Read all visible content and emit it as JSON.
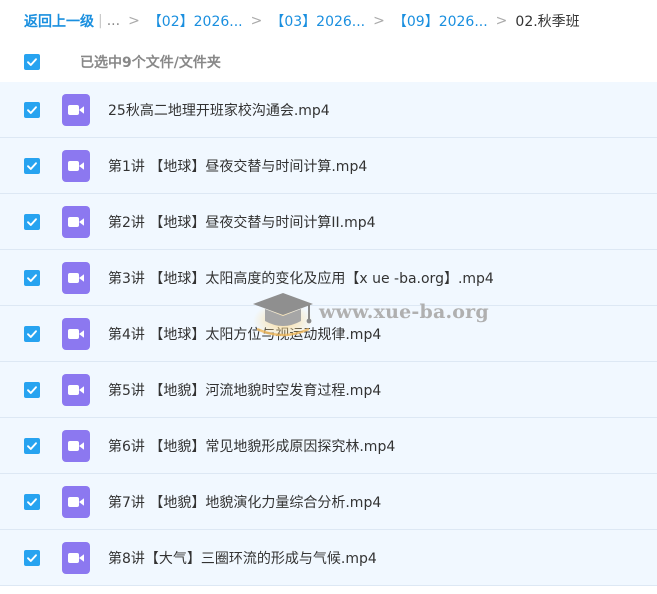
{
  "breadcrumb": {
    "back_label": "返回上一级",
    "separator_pipe": "|",
    "ellipsis": "...",
    "chevron": ">",
    "items": [
      {
        "label": "【02】2026..."
      },
      {
        "label": "【03】2026..."
      },
      {
        "label": "【09】2026..."
      }
    ],
    "current": "02.秋季班"
  },
  "selection": {
    "label": "已选中9个文件/文件夹",
    "all_checked": true
  },
  "files": [
    {
      "name": "25秋高二地理开班家校沟通会.mp4",
      "checked": true,
      "icon": "video-file-icon"
    },
    {
      "name": "第1讲 【地球】昼夜交替与时间计算.mp4",
      "checked": true,
      "icon": "video-file-icon"
    },
    {
      "name": "第2讲 【地球】昼夜交替与时间计算II.mp4",
      "checked": true,
      "icon": "video-file-icon"
    },
    {
      "name": "第3讲 【地球】太阳高度的变化及应用【x ue -ba.org】.mp4",
      "checked": true,
      "icon": "video-file-icon"
    },
    {
      "name": "第4讲 【地球】太阳方位与视运动规律.mp4",
      "checked": true,
      "icon": "video-file-icon"
    },
    {
      "name": "第5讲 【地貌】河流地貌时空发育过程.mp4",
      "checked": true,
      "icon": "video-file-icon"
    },
    {
      "name": "第6讲 【地貌】常见地貌形成原因探究林.mp4",
      "checked": true,
      "icon": "video-file-icon"
    },
    {
      "name": "第7讲 【地貌】地貌演化力量综合分析.mp4",
      "checked": true,
      "icon": "video-file-icon"
    },
    {
      "name": "第8讲【大气】三圈环流的形成与气候.mp4",
      "checked": true,
      "icon": "video-file-icon"
    }
  ],
  "watermark": {
    "text": "www.xue-ba.org"
  },
  "colors": {
    "accent": "#1a8fdf",
    "checkbox": "#27a3f0",
    "video_icon": "#8c78f0",
    "row_background": "#f1f8ff"
  }
}
